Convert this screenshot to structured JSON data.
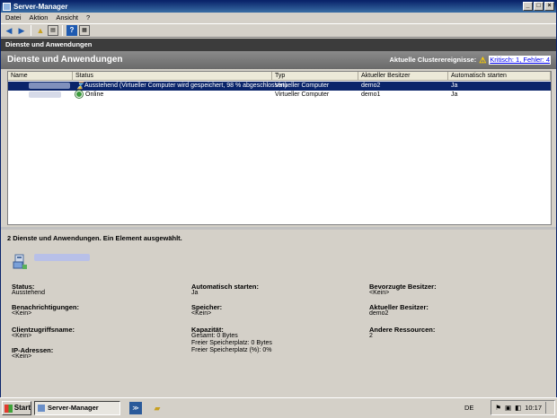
{
  "window": {
    "title": "Server-Manager"
  },
  "menu": [
    "Datei",
    "Aktion",
    "Ansicht",
    "?"
  ],
  "pane_header": "Dienste und Anwendungen",
  "section": {
    "title": "Dienste und Anwendungen",
    "events_label": "Aktuelle Clusterereignisse:",
    "events_link": "Kritisch: 1, Fehler: 4"
  },
  "columns": [
    "Name",
    "Status",
    "Typ",
    "Aktueller Besitzer",
    "Automatisch starten"
  ],
  "rows": [
    {
      "status": "Ausstehend (Virtueller Computer wird gespeichert, 98 % abgeschlossen)",
      "type": "Virtueller Computer",
      "owner": "demo2",
      "autostart": "Ja",
      "status_icon": "hourglass-icon"
    },
    {
      "status": "Online",
      "type": "Virtueller Computer",
      "owner": "demo1",
      "autostart": "Ja",
      "status_icon": "online-icon"
    }
  ],
  "detail": {
    "summary": "2 Dienste und Anwendungen. Ein Element ausgewählt.",
    "fields": {
      "status_label": "Status:",
      "status_value": "Ausstehend",
      "autostart_label": "Automatisch starten:",
      "autostart_value": "Ja",
      "preferred_label": "Bevorzugte Besitzer:",
      "preferred_value": "<Kein>",
      "notify_label": "Benachrichtigungen:",
      "notify_value": "<Kein>",
      "storage_label": "Speicher:",
      "storage_value": "<Kein>",
      "current_owner_label": "Aktueller Besitzer:",
      "current_owner_value": "demo2",
      "client_label": "Clientzugriffsname:",
      "client_value": "<Kein>",
      "capacity_label": "Kapazität:",
      "capacity_total": "Gesamt: 0 Bytes",
      "capacity_free": "Freier Speicherplatz: 0 Bytes",
      "capacity_free_pct": "Freier Speicherplatz (%): 0%",
      "other_label": "Andere Ressourcen:",
      "other_value": "2",
      "ip_label": "IP-Adressen:",
      "ip_value": "<Kein>"
    }
  },
  "taskbar": {
    "start": "Start",
    "task": "Server-Manager",
    "lang": "DE",
    "clock": "10:17"
  }
}
